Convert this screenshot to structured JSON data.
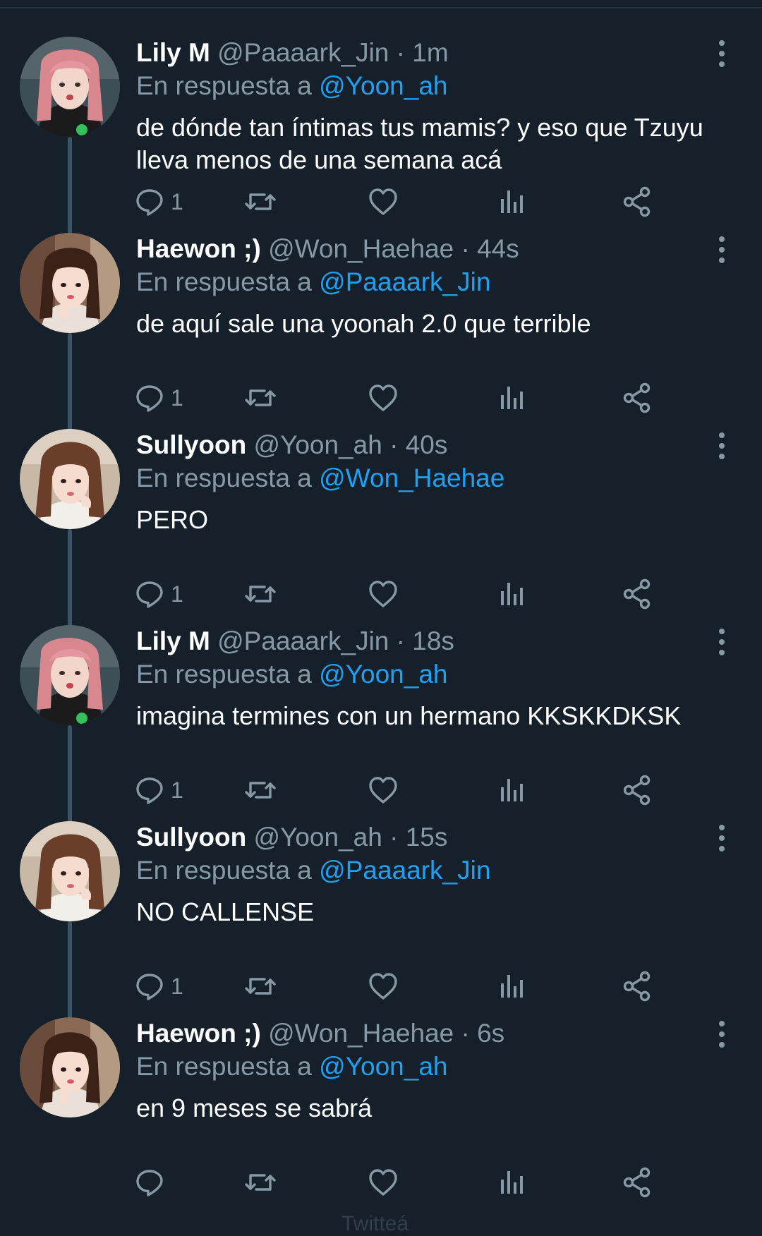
{
  "tweets": [
    {
      "name": "Lily M",
      "handle": "@Paaaark_Jin",
      "time": "· 1m",
      "reply_prefix": "En respuesta a",
      "reply_to": "@Yoon_ah",
      "text": "de dónde tan íntimas tus mamis? y eso que Tzuyu lleva menos de una semana acá",
      "reply_count": "1",
      "avatar": "lily"
    },
    {
      "name": "Haewon ;)",
      "handle": "@Won_Haehae",
      "time": "· 44s",
      "reply_prefix": "En respuesta a",
      "reply_to": "@Paaaark_Jin",
      "text": "de aquí sale una yoonah 2.0 que terrible",
      "reply_count": "1",
      "avatar": "haewon"
    },
    {
      "name": "Sullyoon",
      "handle": "@Yoon_ah",
      "time": "· 40s",
      "reply_prefix": "En respuesta a",
      "reply_to": "@Won_Haehae",
      "text": "PERO",
      "reply_count": "1",
      "avatar": "sullyoon"
    },
    {
      "name": "Lily M",
      "handle": "@Paaaark_Jin",
      "time": "· 18s",
      "reply_prefix": "En respuesta a",
      "reply_to": "@Yoon_ah",
      "text": "imagina termines con un hermano KKSKKDKSK",
      "reply_count": "1",
      "avatar": "lily"
    },
    {
      "name": "Sullyoon",
      "handle": "@Yoon_ah",
      "time": "· 15s",
      "reply_prefix": "En respuesta a",
      "reply_to": "@Paaaark_Jin",
      "text": "NO CALLENSE",
      "reply_count": "1",
      "avatar": "sullyoon"
    },
    {
      "name": "Haewon ;)",
      "handle": "@Won_Haehae",
      "time": "· 6s",
      "reply_prefix": "En respuesta a",
      "reply_to": "@Yoon_ah",
      "text": "en 9 meses se sabrá",
      "reply_count": "",
      "avatar": "haewon"
    }
  ],
  "icons": {
    "reply": "reply-icon",
    "retweet": "retweet-icon",
    "like": "heart-icon",
    "analytics": "analytics-icon",
    "share": "share-icon",
    "more": "more-vertical-icon"
  },
  "colors": {
    "background": "#15202b",
    "name": "#ffffff",
    "secondary": "#8899a6",
    "mention": "#1da1f2",
    "thread_line": "#3d5466"
  },
  "footer_ghost": "Twitteá"
}
